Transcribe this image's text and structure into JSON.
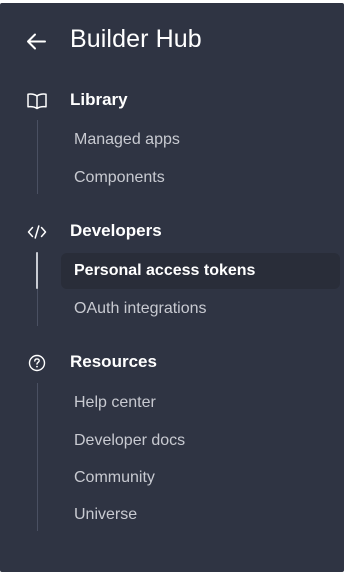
{
  "header": {
    "title": "Builder Hub",
    "back_icon": "arrow-left-icon"
  },
  "sections": [
    {
      "label": "Library",
      "icon": "book-open-icon",
      "items": [
        {
          "label": "Managed apps",
          "active": false
        },
        {
          "label": "Components",
          "active": false
        }
      ]
    },
    {
      "label": "Developers",
      "icon": "code-icon",
      "items": [
        {
          "label": "Personal access tokens",
          "active": true
        },
        {
          "label": "OAuth integrations",
          "active": false
        }
      ]
    },
    {
      "label": "Resources",
      "icon": "question-circle-icon",
      "items": [
        {
          "label": "Help center",
          "active": false
        },
        {
          "label": "Developer docs",
          "active": false
        },
        {
          "label": "Community",
          "active": false
        },
        {
          "label": "Universe",
          "active": false
        }
      ]
    }
  ],
  "colors": {
    "panel_background": "#2f3443",
    "active_item_background": "#292d39",
    "text_primary": "#ffffff",
    "text_secondary": "#c8cad1",
    "rail": "#4a5062"
  }
}
